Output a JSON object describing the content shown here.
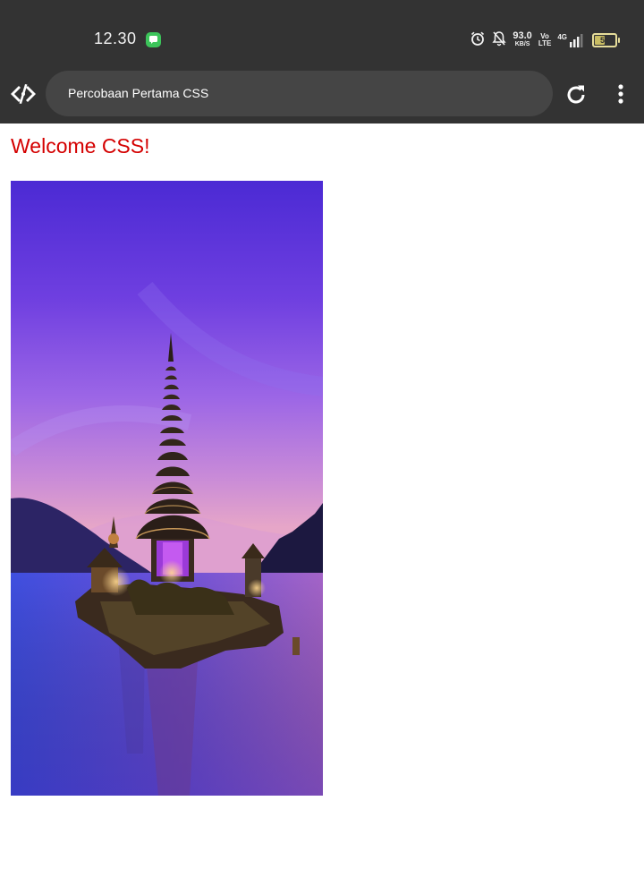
{
  "status_bar": {
    "time": "12.30",
    "net_speed_value": "93.0",
    "net_speed_unit": "KB/S",
    "volte_top": "Vo",
    "volte_bottom": "LTE",
    "network_type": "4G",
    "battery_level": "51",
    "battery_fraction": 0.51,
    "icons": [
      "chat-app-icon",
      "alarm-icon",
      "bell-off-icon",
      "signal-icon",
      "battery-icon"
    ]
  },
  "browser": {
    "url_title": "Percobaan Pertama CSS",
    "icons": [
      "code-icon",
      "reload-icon",
      "more-menu-icon"
    ]
  },
  "page": {
    "heading": "Welcome CSS!",
    "heading_color": "#d40000",
    "image_subject": "pagoda-temple-on-lake-at-dusk"
  },
  "colors": {
    "chrome_background": "#333333",
    "url_pill": "#454545",
    "page_background": "#ffffff"
  }
}
